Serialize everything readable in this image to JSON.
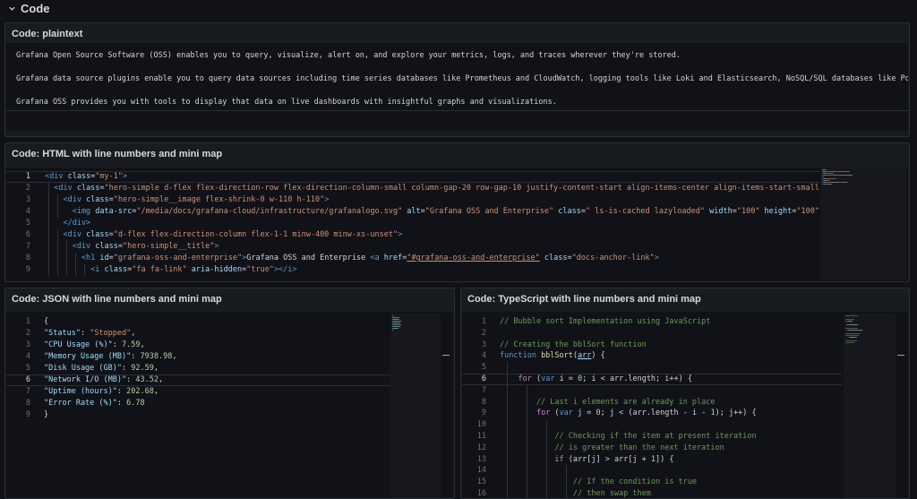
{
  "row": {
    "title": "Code",
    "chevron_icon": "chevron-down-icon"
  },
  "panels": {
    "plaintext": {
      "title": "Code: plaintext",
      "lines": [
        "Grafana Open Source Software (OSS) enables you to query, visualize, alert on, and explore your metrics, logs, and traces wherever they're stored.",
        "",
        "Grafana data source plugins enable you to query data sources including time series databases like Prometheus and CloudWatch, logging tools like Loki and Elasticsearch, NoSQL/SQL databases like Po",
        "",
        "Grafana OSS provides you with tools to display that data on live dashboards with insightful graphs and visualizations."
      ]
    },
    "html": {
      "title": "Code: HTML with line numbers and mini map",
      "line_numbers": [
        "1",
        "2",
        "3",
        "4",
        "5",
        "6",
        "7",
        "8",
        "9"
      ],
      "current_line": 1,
      "lines": [
        [
          {
            "t": "<div ",
            "c": "#569cd6"
          },
          {
            "t": "class",
            "c": "#9cdcfe"
          },
          {
            "t": "=",
            "c": "#d4d4d4"
          },
          {
            "t": "\"my-1\"",
            "c": "#ce9178"
          },
          {
            "t": ">",
            "c": "#569cd6"
          }
        ],
        [
          {
            "t": "  <div ",
            "c": "#569cd6"
          },
          {
            "t": "class",
            "c": "#9cdcfe"
          },
          {
            "t": "=",
            "c": "#d4d4d4"
          },
          {
            "t": "\"hero-simple d-flex flex-direction-row flex-direction-column-small column-gap-20 row-gap-10 justify-content-start align-items-center align-items-start-small",
            "c": "#ce9178"
          }
        ],
        [
          {
            "t": "    <div ",
            "c": "#569cd6"
          },
          {
            "t": "class",
            "c": "#9cdcfe"
          },
          {
            "t": "=",
            "c": "#d4d4d4"
          },
          {
            "t": "\"hero-simple__image flex-shrink-0 w-110 h-110\"",
            "c": "#ce9178"
          },
          {
            "t": ">",
            "c": "#569cd6"
          }
        ],
        [
          {
            "t": "      <img ",
            "c": "#569cd6"
          },
          {
            "t": "data-src",
            "c": "#9cdcfe"
          },
          {
            "t": "=",
            "c": "#d4d4d4"
          },
          {
            "t": "\"/media/docs/grafana-cloud/infrastructure/grafanalogo.svg\"",
            "c": "#ce9178"
          },
          {
            "t": " alt",
            "c": "#9cdcfe"
          },
          {
            "t": "=",
            "c": "#d4d4d4"
          },
          {
            "t": "\"Grafana OSS and Enterprise\"",
            "c": "#ce9178"
          },
          {
            "t": " class",
            "c": "#9cdcfe"
          },
          {
            "t": "=",
            "c": "#d4d4d4"
          },
          {
            "t": "\" ls-is-cached lazyloaded\"",
            "c": "#ce9178"
          },
          {
            "t": " width",
            "c": "#9cdcfe"
          },
          {
            "t": "=",
            "c": "#d4d4d4"
          },
          {
            "t": "\"100\"",
            "c": "#ce9178"
          },
          {
            "t": " height",
            "c": "#9cdcfe"
          },
          {
            "t": "=",
            "c": "#d4d4d4"
          },
          {
            "t": "\"100\"",
            "c": "#ce9178"
          }
        ],
        [
          {
            "t": "    </div>",
            "c": "#569cd6"
          }
        ],
        [
          {
            "t": "    <div ",
            "c": "#569cd6"
          },
          {
            "t": "class",
            "c": "#9cdcfe"
          },
          {
            "t": "=",
            "c": "#d4d4d4"
          },
          {
            "t": "\"d-flex flex-direction-column flex-1-1 minw-400 minw-xs-unset\"",
            "c": "#ce9178"
          },
          {
            "t": ">",
            "c": "#569cd6"
          }
        ],
        [
          {
            "t": "      <div ",
            "c": "#569cd6"
          },
          {
            "t": "class",
            "c": "#9cdcfe"
          },
          {
            "t": "=",
            "c": "#d4d4d4"
          },
          {
            "t": "\"hero-simple__title\"",
            "c": "#ce9178"
          },
          {
            "t": ">",
            "c": "#569cd6"
          }
        ],
        [
          {
            "t": "        <h1 ",
            "c": "#569cd6"
          },
          {
            "t": "id",
            "c": "#9cdcfe"
          },
          {
            "t": "=",
            "c": "#d4d4d4"
          },
          {
            "t": "\"grafana-oss-and-enterprise\"",
            "c": "#ce9178"
          },
          {
            "t": ">",
            "c": "#569cd6"
          },
          {
            "t": "Grafana OSS and Enterprise ",
            "c": "#d4d4d4"
          },
          {
            "t": "<a ",
            "c": "#569cd6"
          },
          {
            "t": "href",
            "c": "#9cdcfe"
          },
          {
            "t": "=",
            "c": "#d4d4d4"
          },
          {
            "t": "\"#grafana-oss-and-enterprise\"",
            "c": "#ce9178",
            "u": true
          },
          {
            "t": " class",
            "c": "#9cdcfe"
          },
          {
            "t": "=",
            "c": "#d4d4d4"
          },
          {
            "t": "\"docs-anchor-link\"",
            "c": "#ce9178"
          },
          {
            "t": ">",
            "c": "#569cd6"
          }
        ],
        [
          {
            "t": "          <i ",
            "c": "#569cd6"
          },
          {
            "t": "class",
            "c": "#9cdcfe"
          },
          {
            "t": "=",
            "c": "#d4d4d4"
          },
          {
            "t": "\"fa fa-link\"",
            "c": "#ce9178"
          },
          {
            "t": " aria-hidden",
            "c": "#9cdcfe"
          },
          {
            "t": "=",
            "c": "#d4d4d4"
          },
          {
            "t": "\"true\"",
            "c": "#ce9178"
          },
          {
            "t": "></i>",
            "c": "#569cd6"
          }
        ]
      ]
    },
    "json": {
      "title": "Code: JSON with line numbers and mini map",
      "line_numbers": [
        "1",
        "2",
        "3",
        "4",
        "5",
        "6",
        "7",
        "8",
        "9"
      ],
      "current_line": 6,
      "lines": [
        [
          {
            "t": "{",
            "c": "#d4d4d4"
          }
        ],
        [
          {
            "t": "\"Status\"",
            "c": "#9cdcfe"
          },
          {
            "t": ": ",
            "c": "#d4d4d4"
          },
          {
            "t": "\"Stopped\"",
            "c": "#ce9178"
          },
          {
            "t": ",",
            "c": "#d4d4d4"
          }
        ],
        [
          {
            "t": "\"CPU Usage (%)\"",
            "c": "#9cdcfe"
          },
          {
            "t": ": ",
            "c": "#d4d4d4"
          },
          {
            "t": "7.59",
            "c": "#b5cea8"
          },
          {
            "t": ",",
            "c": "#d4d4d4"
          }
        ],
        [
          {
            "t": "\"Memory Usage (MB)\"",
            "c": "#9cdcfe"
          },
          {
            "t": ": ",
            "c": "#d4d4d4"
          },
          {
            "t": "7938.98",
            "c": "#b5cea8"
          },
          {
            "t": ",",
            "c": "#d4d4d4"
          }
        ],
        [
          {
            "t": "\"Disk Usage (GB)\"",
            "c": "#9cdcfe"
          },
          {
            "t": ": ",
            "c": "#d4d4d4"
          },
          {
            "t": "92.59",
            "c": "#b5cea8"
          },
          {
            "t": ",",
            "c": "#d4d4d4"
          }
        ],
        [
          {
            "t": "\"Network I/O (MB)\"",
            "c": "#9cdcfe"
          },
          {
            "t": ": ",
            "c": "#d4d4d4"
          },
          {
            "t": "43.52",
            "c": "#b5cea8"
          },
          {
            "t": ",",
            "c": "#d4d4d4"
          }
        ],
        [
          {
            "t": "\"Uptime (hours)\"",
            "c": "#9cdcfe"
          },
          {
            "t": ": ",
            "c": "#d4d4d4"
          },
          {
            "t": "202.68",
            "c": "#b5cea8"
          },
          {
            "t": ",",
            "c": "#d4d4d4"
          }
        ],
        [
          {
            "t": "\"Error Rate (%)\"",
            "c": "#9cdcfe"
          },
          {
            "t": ": ",
            "c": "#d4d4d4"
          },
          {
            "t": "6.78",
            "c": "#b5cea8"
          }
        ],
        [
          {
            "t": "}",
            "c": "#d4d4d4"
          }
        ]
      ]
    },
    "typescript": {
      "title": "Code: TypeScript with line numbers and mini map",
      "line_numbers": [
        "1",
        "2",
        "3",
        "4",
        "5",
        "6",
        "7",
        "8",
        "9",
        "10",
        "11",
        "12",
        "13",
        "14",
        "15",
        "16"
      ],
      "current_line": 6,
      "lines": [
        [
          {
            "t": "// Bubble sort Implementation using JavaScript",
            "c": "#6a9955"
          }
        ],
        [],
        [
          {
            "t": "// Creating the bblSort function",
            "c": "#6a9955"
          }
        ],
        [
          {
            "t": "function ",
            "c": "#569cd6"
          },
          {
            "t": "bblSort",
            "c": "#dcdcaa"
          },
          {
            "t": "(",
            "c": "#d4d4d4"
          },
          {
            "t": "arr",
            "c": "#9cdcfe",
            "u": true
          },
          {
            "t": ") {",
            "c": "#d4d4d4"
          }
        ],
        [],
        [
          {
            "t": "    ",
            "c": "#d4d4d4"
          },
          {
            "t": "for",
            "c": "#c586c0"
          },
          {
            "t": " (",
            "c": "#d4d4d4"
          },
          {
            "t": "var",
            "c": "#569cd6"
          },
          {
            "t": " i = ",
            "c": "#d4d4d4"
          },
          {
            "t": "0",
            "c": "#b5cea8"
          },
          {
            "t": "; i < arr.length; i++) {",
            "c": "#d4d4d4"
          }
        ],
        [],
        [
          {
            "t": "        // Last i elements are already in place",
            "c": "#6a9955"
          }
        ],
        [
          {
            "t": "        ",
            "c": "#d4d4d4"
          },
          {
            "t": "for",
            "c": "#c586c0"
          },
          {
            "t": " (",
            "c": "#d4d4d4"
          },
          {
            "t": "var",
            "c": "#569cd6"
          },
          {
            "t": " j = ",
            "c": "#d4d4d4"
          },
          {
            "t": "0",
            "c": "#b5cea8"
          },
          {
            "t": "; j < (arr.length - i - ",
            "c": "#d4d4d4"
          },
          {
            "t": "1",
            "c": "#b5cea8"
          },
          {
            "t": "); j++) {",
            "c": "#d4d4d4"
          }
        ],
        [],
        [
          {
            "t": "            // Checking if the item at present iteration",
            "c": "#6a9955"
          }
        ],
        [
          {
            "t": "            // is greater than the next iteration",
            "c": "#6a9955"
          }
        ],
        [
          {
            "t": "            ",
            "c": "#d4d4d4"
          },
          {
            "t": "if",
            "c": "#c586c0"
          },
          {
            "t": " (arr[j] > arr[j + ",
            "c": "#d4d4d4"
          },
          {
            "t": "1",
            "c": "#b5cea8"
          },
          {
            "t": "]) {",
            "c": "#d4d4d4"
          }
        ],
        [],
        [
          {
            "t": "                // If the condition is true",
            "c": "#6a9955"
          }
        ],
        [
          {
            "t": "                // then swap them",
            "c": "#6a9955"
          }
        ]
      ]
    }
  }
}
